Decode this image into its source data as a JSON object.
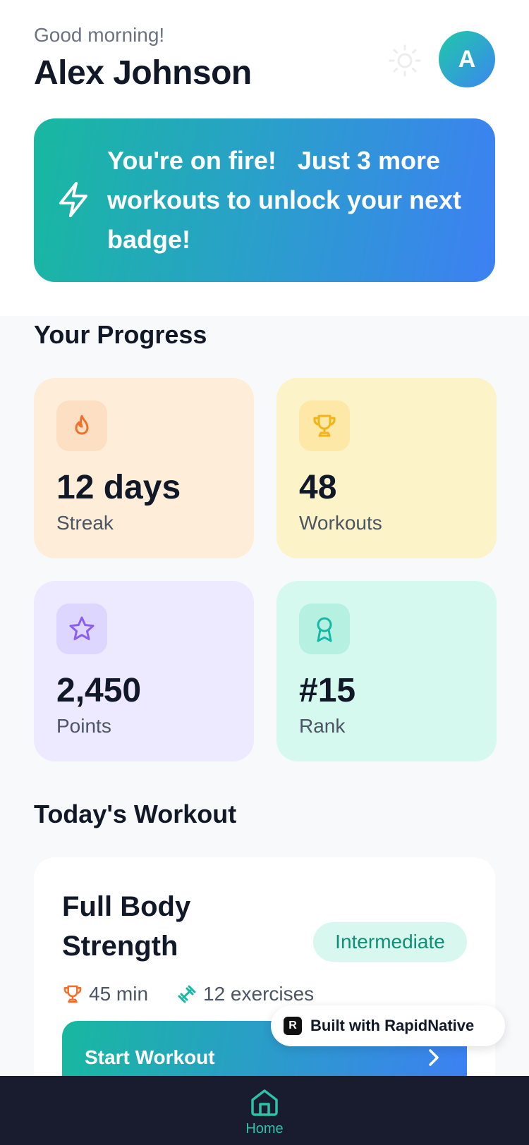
{
  "header": {
    "greeting": "Good morning!",
    "name": "Alex Johnson",
    "avatar_initial": "A",
    "theme_icon": "sun-icon"
  },
  "banner": {
    "icon": "lightning-icon",
    "text": "You're on fire!   Just 3 more workouts to unlock your next badge!"
  },
  "progress": {
    "title": "Your Progress",
    "cards": [
      {
        "icon": "flame-icon",
        "value": "12 days",
        "label": "Streak",
        "bg": "#feeed9",
        "icon_bg": "#fddfc4",
        "icon_color": "#f2702a"
      },
      {
        "icon": "trophy-icon",
        "value": "48",
        "label": "Workouts",
        "bg": "#fdf3c8",
        "icon_bg": "#fde8a8",
        "icon_color": "#f0b418"
      },
      {
        "icon": "star-icon",
        "value": "2,450",
        "label": "Points",
        "bg": "#ede9fe",
        "icon_bg": "#ddd6fe",
        "icon_color": "#8b5cf6"
      },
      {
        "icon": "award-icon",
        "value": "#15",
        "label": "Rank",
        "bg": "#d5f9ef",
        "icon_bg": "#b5f0e0",
        "icon_color": "#14b8a6"
      }
    ]
  },
  "today": {
    "title": "Today's Workout",
    "workout_name": "Full Body Strength",
    "level": "Intermediate",
    "duration": "45 min",
    "exercises": "12 exercises",
    "start_label": "Start Workout"
  },
  "badge": {
    "logo": "R",
    "text": "Built with RapidNative"
  },
  "nav": {
    "home_label": "Home",
    "accent": "#2bc3a6"
  }
}
